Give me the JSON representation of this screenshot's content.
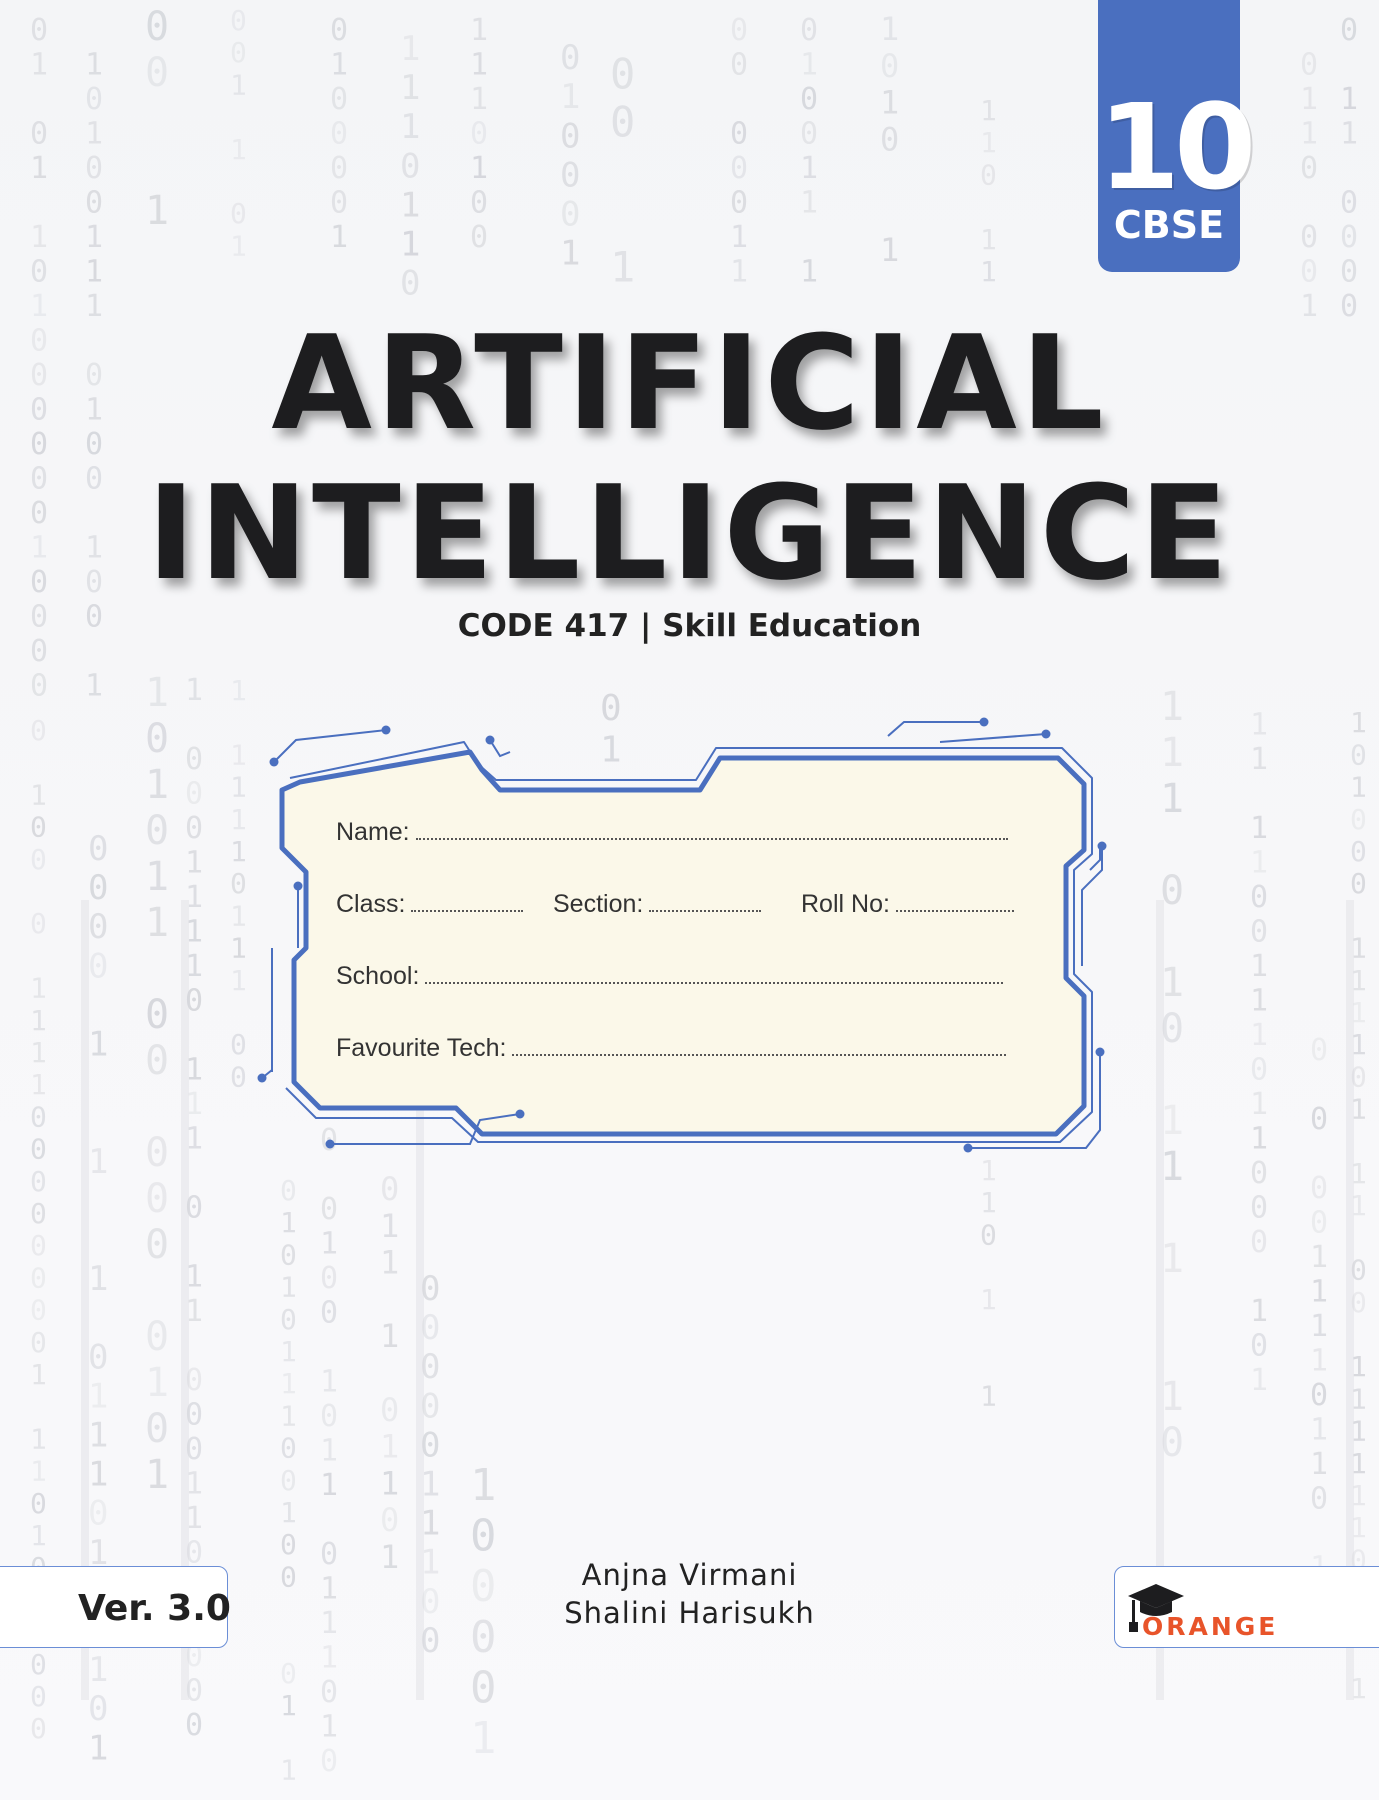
{
  "badge": {
    "grade": "10",
    "board": "CBSE"
  },
  "title": {
    "line1": "ARTIFICIAL",
    "line2": "INTELLIGENCE"
  },
  "subtitle": "CODE 417 | Skill Education",
  "form": {
    "name_label": "Name:",
    "class_label": "Class:",
    "section_label": "Section:",
    "roll_label": "Roll No:",
    "school_label": "School:",
    "tech_label": "Favourite Tech:"
  },
  "version": "Ver. 3.0",
  "authors": [
    "Anjna Virmani",
    "Shalini Harisukh"
  ],
  "publisher": {
    "name": "ORANGE",
    "logo_icon": "graduation-cap-icon"
  },
  "colors": {
    "accent_blue": "#4a6fbf",
    "frame_fill": "#fbf8e9",
    "publisher_orange": "#e8542a"
  }
}
